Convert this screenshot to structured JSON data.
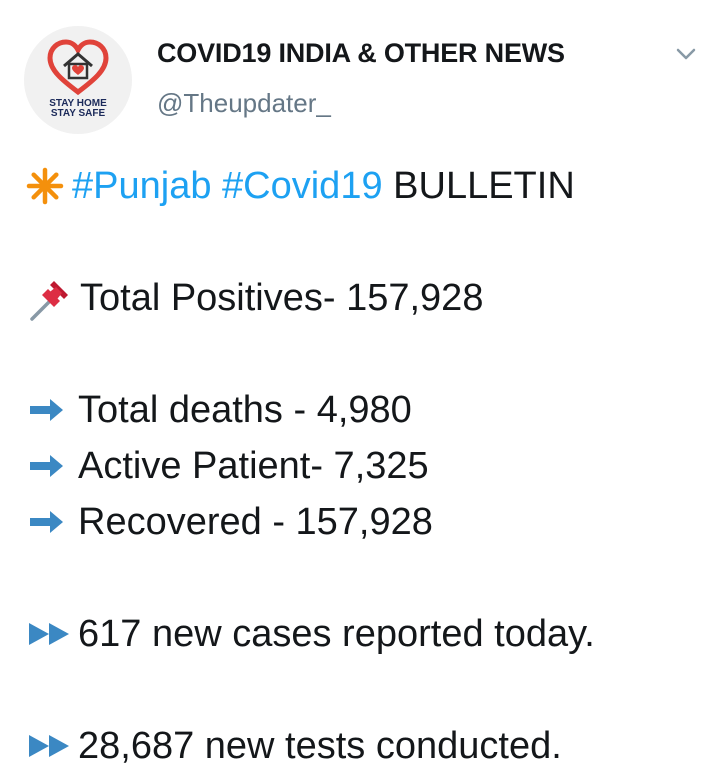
{
  "tweet": {
    "author": {
      "display_name": "COVID19 INDIA & OTHER NEWS",
      "handle": "@Theupdater_",
      "avatar_text_line1": "STAY HOME",
      "avatar_text_line2": "STAY SAFE"
    },
    "title_line": {
      "hashtag1": "#Punjab",
      "hashtag2": "#Covid19",
      "text": "BULLETIN"
    },
    "total_positives": "Total Positives- 157,928",
    "stats": [
      "Total deaths - 4,980",
      "Active Patient- 7,325",
      "Recovered - 157,928"
    ],
    "new_cases": "617 new cases reported today.",
    "new_tests": "28,687 new tests conducted.",
    "icons": {
      "title": "eight-spoked-asterisk-icon",
      "positives": "pushpin-icon",
      "stats": "right-arrow-icon",
      "updates": "fast-forward-icon",
      "menu": "chevron-down-icon"
    },
    "colors": {
      "hashtag": "#1da1f2",
      "asterisk": "#f4900c",
      "arrow": "#3b88c3",
      "pushpin": "#dd2e44"
    }
  }
}
